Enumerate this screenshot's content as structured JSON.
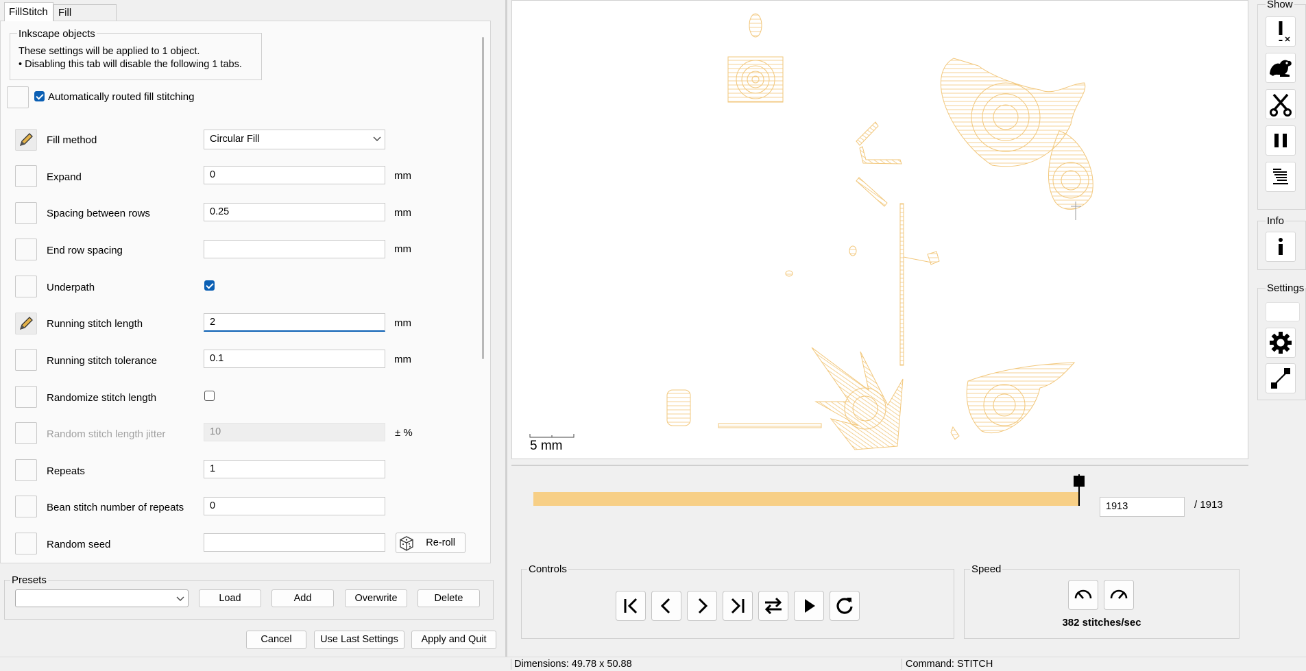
{
  "tabs": [
    {
      "label": "FillStitch",
      "active": true
    },
    {
      "label": "Fill Underlay",
      "active": false
    }
  ],
  "info": {
    "legend": "Inkscape objects",
    "line1": "These settings will be applied to 1 object.",
    "line2": "• Disabling this tab will disable the following 1 tabs."
  },
  "auto_fill": {
    "label": "Automatically routed fill stitching",
    "checked": true
  },
  "params": [
    {
      "label": "Fill method",
      "value": "Circular Fill",
      "unit": "",
      "kind": "select"
    },
    {
      "label": "Expand",
      "value": "0",
      "unit": "mm",
      "kind": "text"
    },
    {
      "label": "Spacing between rows",
      "value": "0.25",
      "unit": "mm",
      "kind": "text"
    },
    {
      "label": "End row spacing",
      "value": "",
      "unit": "mm",
      "kind": "text"
    },
    {
      "label": "Underpath",
      "value": "",
      "unit": "",
      "kind": "checkbox",
      "checked": true
    },
    {
      "label": "Running stitch length",
      "value": "2",
      "unit": "mm",
      "kind": "text"
    },
    {
      "label": "Running stitch tolerance",
      "value": "0.1",
      "unit": "mm",
      "kind": "text"
    },
    {
      "label": "Randomize stitch length",
      "value": "",
      "unit": "",
      "kind": "checkbox",
      "checked": false
    },
    {
      "label": "Random stitch length jitter",
      "value": "10",
      "unit": "± %",
      "kind": "text"
    },
    {
      "label": "Repeats",
      "value": "1",
      "unit": "",
      "kind": "text"
    },
    {
      "label": "Bean stitch number of repeats",
      "value": "0",
      "unit": "",
      "kind": "text"
    },
    {
      "label": "Random seed",
      "value": "",
      "unit": "",
      "kind": "text",
      "button": "Re-roll"
    }
  ],
  "presets": {
    "legend": "Presets",
    "selected": "",
    "buttons": {
      "load": "Load",
      "add": "Add",
      "overwrite": "Overwrite",
      "delete": "Delete"
    }
  },
  "dialog_buttons": {
    "cancel": "Cancel",
    "use_last": "Use Last Settings",
    "apply": "Apply and Quit"
  },
  "canvas": {
    "scale_label": "5 mm",
    "stitch_color": "#f2c77b"
  },
  "slider": {
    "value": "1913",
    "total": "/ 1913",
    "progress": 1.0,
    "color": "#f7cf86"
  },
  "controls": {
    "legend": "Controls"
  },
  "speed": {
    "legend": "Speed",
    "label": "382 stitches/sec"
  },
  "toolbar": {
    "show_legend": "Show",
    "show_tools": [
      "error-icon",
      "jump-icon",
      "trim-icon",
      "stop-icon",
      "color-change-icon"
    ],
    "info_legend": "Info",
    "settings_legend": "Settings"
  },
  "status": {
    "dimensions": "Dimensions: 49.78 x 50.88",
    "command": "Command: STITCH"
  }
}
